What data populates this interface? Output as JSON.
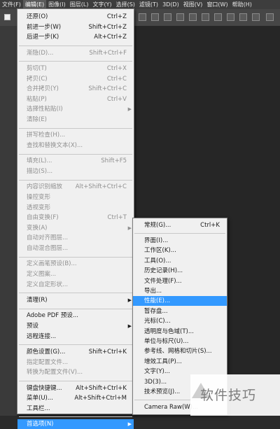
{
  "menubar": {
    "items": [
      "文件(F)",
      "编辑(E)",
      "图像(I)",
      "图层(L)",
      "文字(Y)",
      "选择(S)",
      "滤镜(T)",
      "3D(D)",
      "视图(V)",
      "窗口(W)",
      "帮助(H)"
    ],
    "active_index": 1
  },
  "edit_menu": {
    "items": [
      {
        "label": "还原(O)",
        "shortcut": "Ctrl+Z",
        "disabled": false
      },
      {
        "label": "前进一步(W)",
        "shortcut": "Shift+Ctrl+Z",
        "disabled": false
      },
      {
        "label": "后退一步(K)",
        "shortcut": "Alt+Ctrl+Z",
        "disabled": false
      },
      {
        "sep": true
      },
      {
        "label": "渐隐(D)...",
        "shortcut": "Shift+Ctrl+F",
        "disabled": true
      },
      {
        "sep": true
      },
      {
        "label": "剪切(T)",
        "shortcut": "Ctrl+X",
        "disabled": true
      },
      {
        "label": "拷贝(C)",
        "shortcut": "Ctrl+C",
        "disabled": true
      },
      {
        "label": "合并拷贝(Y)",
        "shortcut": "Shift+Ctrl+C",
        "disabled": true
      },
      {
        "label": "粘贴(P)",
        "shortcut": "Ctrl+V",
        "disabled": true
      },
      {
        "label": "选择性粘贴(I)",
        "shortcut": "",
        "disabled": true,
        "submenu": true
      },
      {
        "label": "清除(E)",
        "shortcut": "",
        "disabled": true
      },
      {
        "sep": true
      },
      {
        "label": "拼写检查(H)...",
        "shortcut": "",
        "disabled": true
      },
      {
        "label": "查找和替换文本(X)...",
        "shortcut": "",
        "disabled": true
      },
      {
        "sep": true
      },
      {
        "label": "填充(L)...",
        "shortcut": "Shift+F5",
        "disabled": true
      },
      {
        "label": "描边(S)...",
        "shortcut": "",
        "disabled": true
      },
      {
        "sep": true
      },
      {
        "label": "内容识别缩放",
        "shortcut": "Alt+Shift+Ctrl+C",
        "disabled": true
      },
      {
        "label": "操控变形",
        "shortcut": "",
        "disabled": true
      },
      {
        "label": "透视变形",
        "shortcut": "",
        "disabled": true
      },
      {
        "label": "自由变换(F)",
        "shortcut": "Ctrl+T",
        "disabled": true
      },
      {
        "label": "变换(A)",
        "shortcut": "",
        "disabled": true,
        "submenu": true
      },
      {
        "label": "自动对齐图层...",
        "shortcut": "",
        "disabled": true
      },
      {
        "label": "自动混合图层...",
        "shortcut": "",
        "disabled": true
      },
      {
        "sep": true
      },
      {
        "label": "定义画笔预设(B)...",
        "shortcut": "",
        "disabled": true
      },
      {
        "label": "定义图案...",
        "shortcut": "",
        "disabled": true
      },
      {
        "label": "定义自定形状...",
        "shortcut": "",
        "disabled": true
      },
      {
        "sep": true
      },
      {
        "label": "清理(R)",
        "shortcut": "",
        "disabled": false,
        "submenu": true
      },
      {
        "sep": true
      },
      {
        "label": "Adobe PDF 预设...",
        "shortcut": "",
        "disabled": false
      },
      {
        "label": "预设",
        "shortcut": "",
        "disabled": false,
        "submenu": true
      },
      {
        "label": "远程连接...",
        "shortcut": "",
        "disabled": false
      },
      {
        "sep": true
      },
      {
        "label": "颜色设置(G)...",
        "shortcut": "Shift+Ctrl+K",
        "disabled": false
      },
      {
        "label": "指定配置文件...",
        "shortcut": "",
        "disabled": true
      },
      {
        "label": "转换为配置文件(V)...",
        "shortcut": "",
        "disabled": true
      },
      {
        "sep": true
      },
      {
        "label": "键盘快捷键...",
        "shortcut": "Alt+Shift+Ctrl+K",
        "disabled": false
      },
      {
        "label": "菜单(U)...",
        "shortcut": "Alt+Shift+Ctrl+M",
        "disabled": false
      },
      {
        "label": "工具栏...",
        "shortcut": "",
        "disabled": false
      },
      {
        "sep": true
      },
      {
        "label": "首选项(N)",
        "shortcut": "",
        "disabled": false,
        "submenu": true,
        "highlighted": true
      }
    ]
  },
  "prefs_menu": {
    "items": [
      {
        "label": "常规(G)...",
        "shortcut": "Ctrl+K"
      },
      {
        "sep": true
      },
      {
        "label": "界面(I)...",
        "shortcut": ""
      },
      {
        "label": "工作区(K)...",
        "shortcut": ""
      },
      {
        "label": "工具(O)...",
        "shortcut": ""
      },
      {
        "label": "历史记录(H)...",
        "shortcut": ""
      },
      {
        "label": "文件处理(F)...",
        "shortcut": ""
      },
      {
        "label": "导出...",
        "shortcut": ""
      },
      {
        "label": "性能(E)...",
        "shortcut": "",
        "highlighted": true
      },
      {
        "label": "暂存盘...",
        "shortcut": ""
      },
      {
        "label": "光标(C)...",
        "shortcut": ""
      },
      {
        "label": "透明度与色域(T)...",
        "shortcut": ""
      },
      {
        "label": "单位与标尺(U)...",
        "shortcut": ""
      },
      {
        "label": "参考线、网格和切片(S)...",
        "shortcut": ""
      },
      {
        "label": "增效工具(P)...",
        "shortcut": ""
      },
      {
        "label": "文字(Y)...",
        "shortcut": ""
      },
      {
        "label": "3D(3)...",
        "shortcut": ""
      },
      {
        "label": "技术预览(J)...",
        "shortcut": ""
      },
      {
        "sep": true
      },
      {
        "label": "Camera Raw(W)...",
        "shortcut": ""
      }
    ]
  },
  "watermark": {
    "text": "软件技巧"
  },
  "colors": {
    "highlight": "#3399ff",
    "menu_bg": "#f0f0f0",
    "disabled": "#8f8f8f"
  }
}
